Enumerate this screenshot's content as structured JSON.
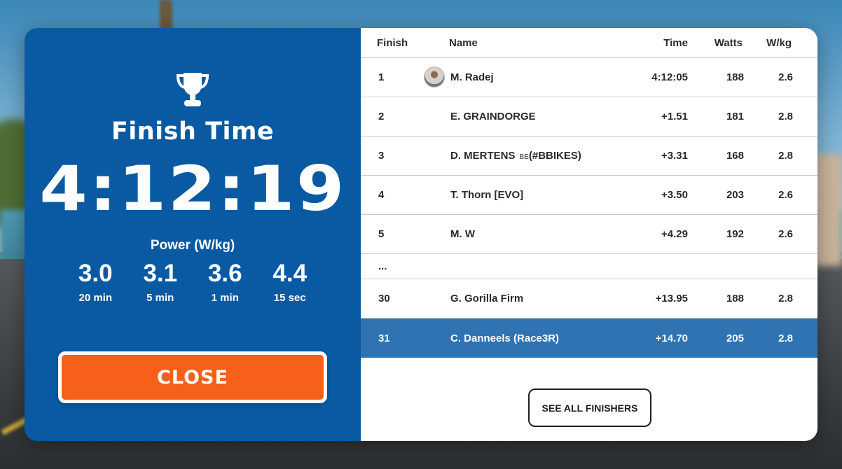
{
  "left_panel": {
    "title": "Finish Time",
    "finish_time": "4:12:19",
    "power_label": "Power (W/kg)",
    "power_stats": [
      {
        "value": "3.0",
        "label": "20 min"
      },
      {
        "value": "3.1",
        "label": "5 min"
      },
      {
        "value": "3.6",
        "label": "1 min"
      },
      {
        "value": "4.4",
        "label": "15 sec"
      }
    ],
    "close_label": "CLOSE",
    "trophy_icon": "trophy-icon"
  },
  "results": {
    "headers": {
      "finish": "Finish",
      "name": "Name",
      "time": "Time",
      "watts": "Watts",
      "wkg": "W/kg"
    },
    "rows": [
      {
        "finish": "1",
        "name": "M. Radej",
        "tag": "",
        "time": "4:12:05",
        "watts": "188",
        "wkg": "2.6",
        "avatar": true
      },
      {
        "finish": "2",
        "name": "E. GRAINDORGE",
        "tag": "",
        "time": "+1.51",
        "watts": "181",
        "wkg": "2.8"
      },
      {
        "finish": "3",
        "name": "D. MERTENS",
        "tag": "BE",
        "name_suffix": "(#BBIKES)",
        "time": "+3.31",
        "watts": "168",
        "wkg": "2.8"
      },
      {
        "finish": "4",
        "name": "T. Thorn [EVO]",
        "tag": "",
        "time": "+3.50",
        "watts": "203",
        "wkg": "2.6"
      },
      {
        "finish": "5",
        "name": "M. W",
        "tag": "",
        "time": "+4.29",
        "watts": "192",
        "wkg": "2.6"
      },
      {
        "finish": "...",
        "name": "",
        "time": "",
        "watts": "",
        "wkg": ""
      },
      {
        "finish": "30",
        "name": "G. Gorilla Firm",
        "tag": "",
        "time": "+13.95",
        "watts": "188",
        "wkg": "2.8"
      },
      {
        "finish": "31",
        "name": "C. Danneels (Race3R)",
        "tag": "",
        "time": "+14.70",
        "watts": "205",
        "wkg": "2.8",
        "highlighted": true
      }
    ],
    "see_all_label": "SEE ALL FINISHERS"
  },
  "colors": {
    "left_panel_bg": "#0a5aa3",
    "close_button": "#f6601a",
    "highlight_row": "#2f73b2"
  }
}
